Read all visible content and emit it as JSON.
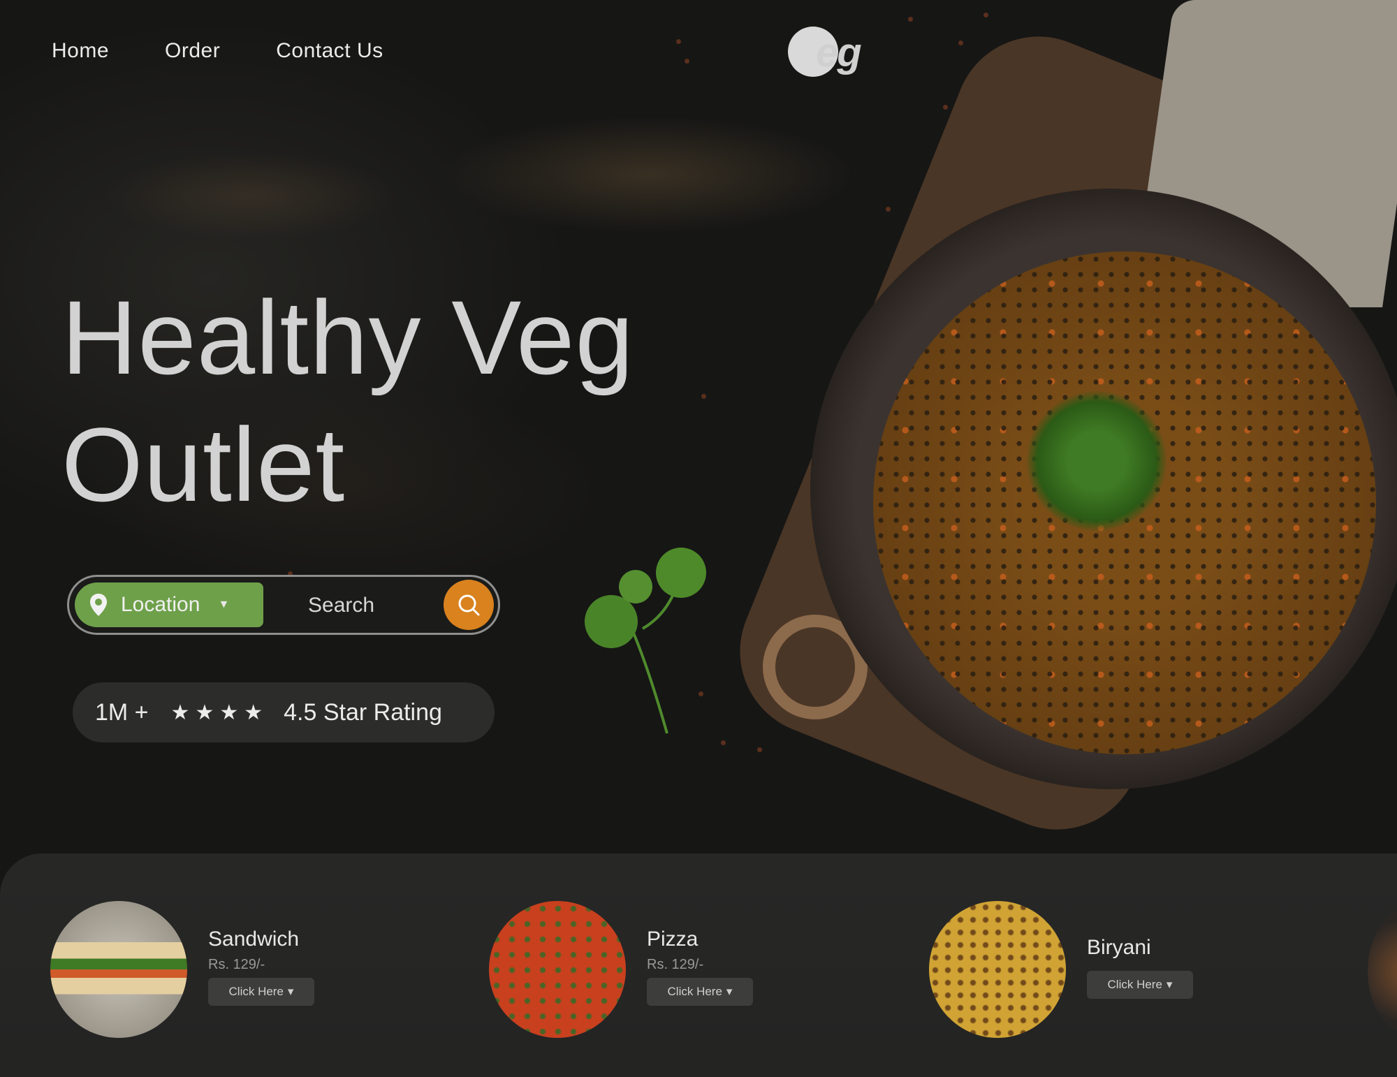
{
  "nav": {
    "items": [
      "Home",
      "Order",
      "Contact Us"
    ],
    "logo_text": "eg"
  },
  "hero": {
    "line1": "Healthy Veg",
    "line2": "Outlet"
  },
  "search": {
    "location_label": "Location",
    "placeholder": "Search"
  },
  "rating": {
    "count": "1M +",
    "stars": "★★★★",
    "text": "4.5 Star Rating"
  },
  "cards": [
    {
      "name": "Sandwich",
      "price": "Rs. 129/-",
      "button": "Click Here"
    },
    {
      "name": "Pizza",
      "price": "Rs. 129/-",
      "button": "Click Here"
    },
    {
      "name": "Biryani",
      "button": "Click Here"
    }
  ],
  "colors": {
    "accent_green": "#6ea04a",
    "accent_orange": "#d9821e",
    "background": "#151514"
  },
  "icons": [
    "location-pin-icon",
    "chevron-down-icon",
    "search-icon"
  ]
}
